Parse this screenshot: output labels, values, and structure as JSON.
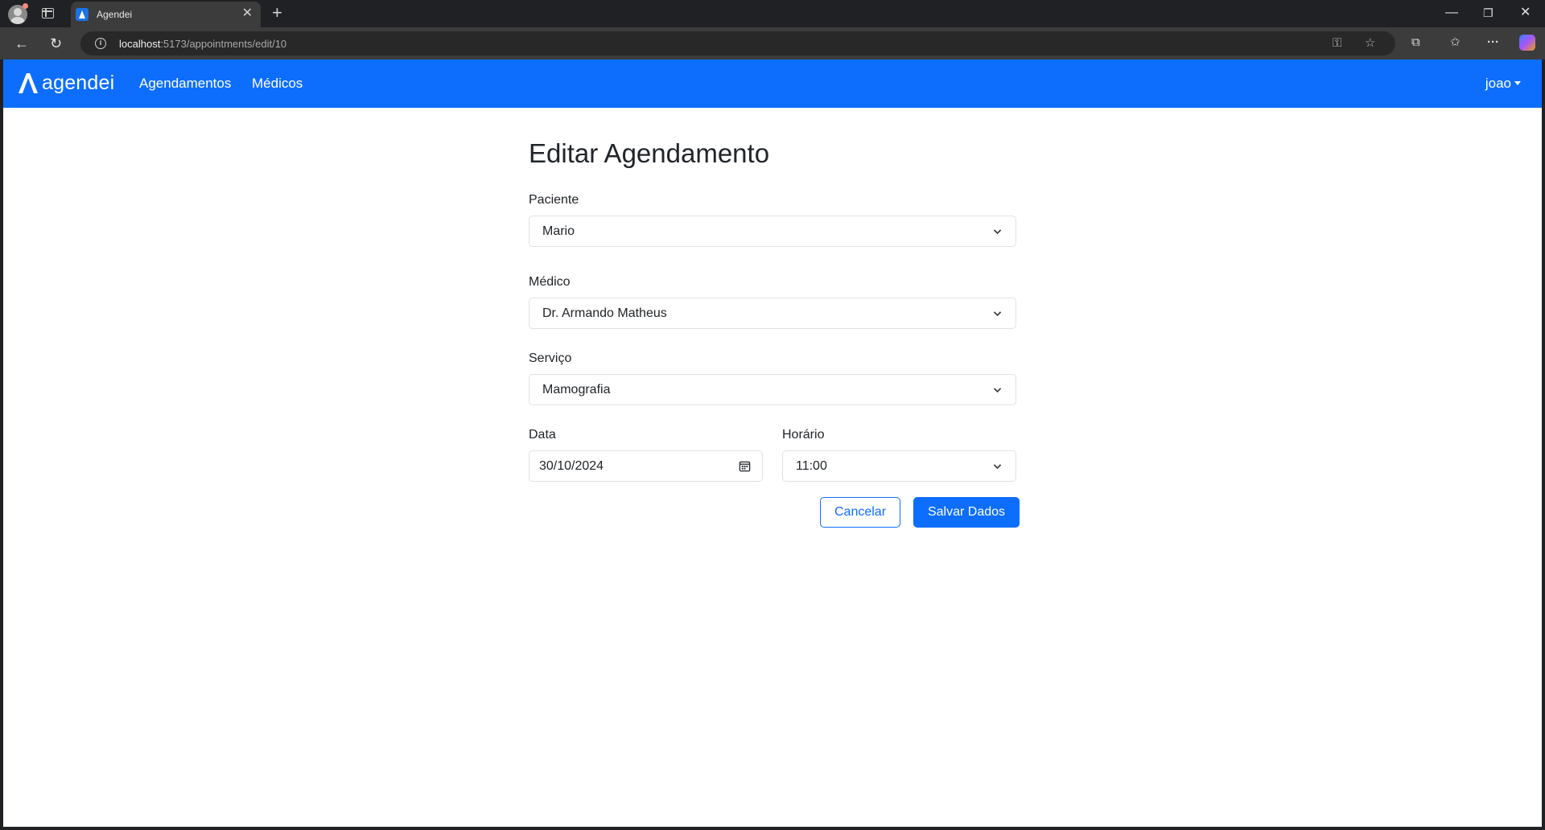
{
  "browser": {
    "tab_title": "Agendei",
    "url_host": "localhost",
    "url_path": ":5173/appointments/edit/10"
  },
  "navbar": {
    "brand": "agendei",
    "links": [
      {
        "label": "Agendamentos"
      },
      {
        "label": "Médicos"
      }
    ],
    "user": "joao"
  },
  "form": {
    "title": "Editar Agendamento",
    "patient": {
      "label": "Paciente",
      "value": "Mario"
    },
    "doctor": {
      "label": "Médico",
      "value": "Dr. Armando Matheus"
    },
    "service": {
      "label": "Serviço",
      "value": "Mamografia"
    },
    "date": {
      "label": "Data",
      "value": "30/10/2024"
    },
    "time": {
      "label": "Horário",
      "value": "11:00"
    },
    "cancel_label": "Cancelar",
    "save_label": "Salvar Dados"
  },
  "colors": {
    "primary": "#0d6efd",
    "text": "#212529",
    "border": "#dee2e6"
  }
}
